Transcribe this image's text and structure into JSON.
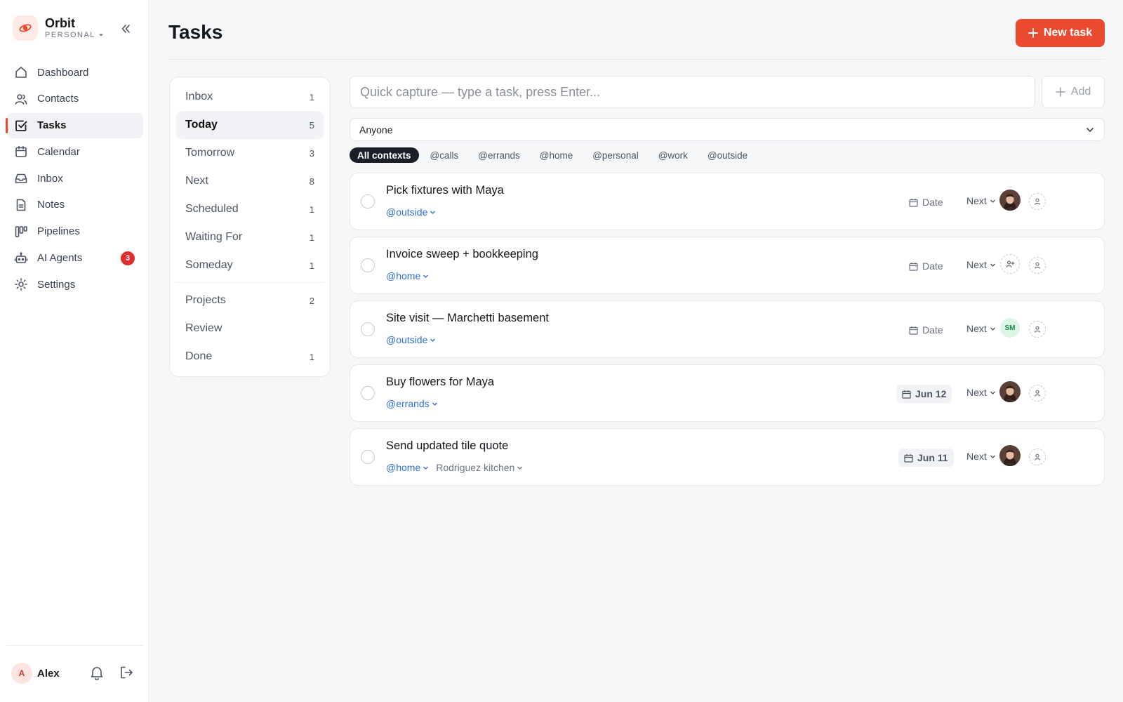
{
  "brand": {
    "name": "Orbit",
    "workspace": "PERSONAL"
  },
  "nav": [
    {
      "label": "Dashboard",
      "icon": "home-icon"
    },
    {
      "label": "Contacts",
      "icon": "users-icon"
    },
    {
      "label": "Tasks",
      "icon": "check-square-icon",
      "active": true
    },
    {
      "label": "Calendar",
      "icon": "calendar-icon"
    },
    {
      "label": "Inbox",
      "icon": "inbox-icon"
    },
    {
      "label": "Notes",
      "icon": "notes-icon"
    },
    {
      "label": "Pipelines",
      "icon": "kanban-icon"
    },
    {
      "label": "AI Agents",
      "icon": "robot-icon",
      "badge": "3"
    },
    {
      "label": "Settings",
      "icon": "gear-icon"
    }
  ],
  "user": {
    "initial": "A",
    "name": "Alex"
  },
  "header": {
    "title": "Tasks",
    "new_task_label": "New task"
  },
  "views": {
    "primary": [
      {
        "label": "Inbox",
        "count": "1"
      },
      {
        "label": "Today",
        "count": "5",
        "active": true
      },
      {
        "label": "Tomorrow",
        "count": "3"
      },
      {
        "label": "Next",
        "count": "8"
      },
      {
        "label": "Scheduled",
        "count": "1"
      },
      {
        "label": "Waiting For",
        "count": "1"
      },
      {
        "label": "Someday",
        "count": "1"
      }
    ],
    "secondary": [
      {
        "label": "Projects",
        "count": "2"
      },
      {
        "label": "Review",
        "count": ""
      },
      {
        "label": "Done",
        "count": "1"
      }
    ]
  },
  "capture": {
    "placeholder": "Quick capture — type a task, press Enter...",
    "add_label": "Add"
  },
  "assignee_filter": {
    "value": "Anyone"
  },
  "contexts": [
    "All contexts",
    "@calls",
    "@errands",
    "@home",
    "@personal",
    "@work",
    "@outside"
  ],
  "tasks": [
    {
      "title": "Pick fixtures with Maya",
      "context": "@outside",
      "project": "",
      "date": "Date",
      "date_set": false,
      "status": "Next",
      "assignee": "photo"
    },
    {
      "title": "Invoice sweep + bookkeeping",
      "context": "@home",
      "project": "",
      "date": "Date",
      "date_set": false,
      "status": "Next",
      "assignee": "add"
    },
    {
      "title": "Site visit — Marchetti basement",
      "context": "@outside",
      "project": "",
      "date": "Date",
      "date_set": false,
      "status": "Next",
      "assignee": "SM"
    },
    {
      "title": "Buy flowers for Maya",
      "context": "@errands",
      "project": "",
      "date": "Jun 12",
      "date_set": true,
      "status": "Next",
      "assignee": "photo"
    },
    {
      "title": "Send updated tile quote",
      "context": "@home",
      "project": "Rodriguez kitchen",
      "date": "Jun 11",
      "date_set": true,
      "status": "Next",
      "assignee": "photo"
    }
  ],
  "colors": {
    "accent": "#ea4a2f",
    "link": "#2f6fd1",
    "badge": "#e02d2d",
    "active_chip": "#1b1f2a"
  }
}
